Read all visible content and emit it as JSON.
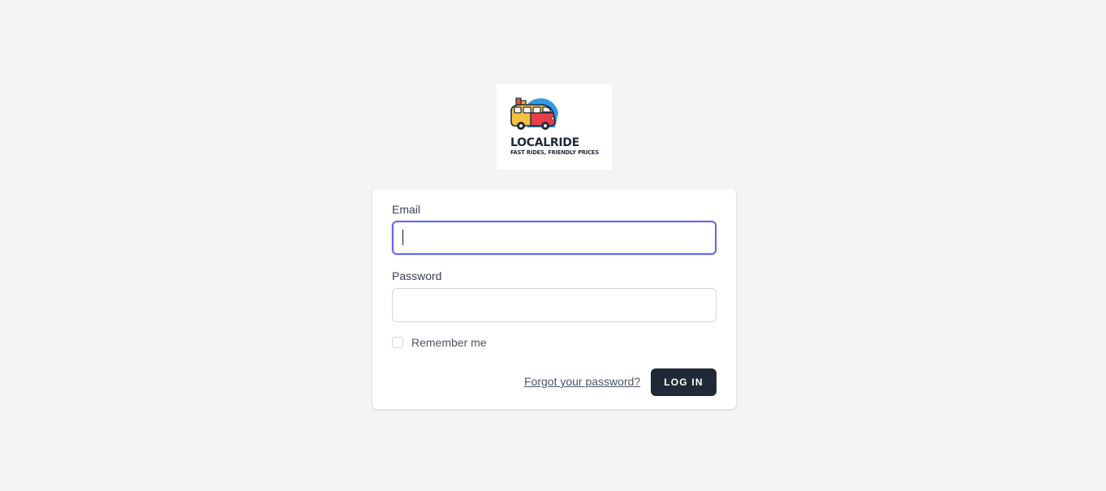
{
  "logo": {
    "name": "LOCALRIDE",
    "tagline": "FAST RIDES, FRIENDLY PRICES"
  },
  "form": {
    "email_label": "Email",
    "email_value": "",
    "password_label": "Password",
    "password_value": "",
    "remember_label": "Remember me",
    "remember_checked": false,
    "forgot_link": "Forgot your password?",
    "login_button": "LOG IN"
  },
  "colors": {
    "page_background": "#f3f4f6",
    "focus_ring": "#6366f1",
    "button_background": "#1f2937"
  }
}
